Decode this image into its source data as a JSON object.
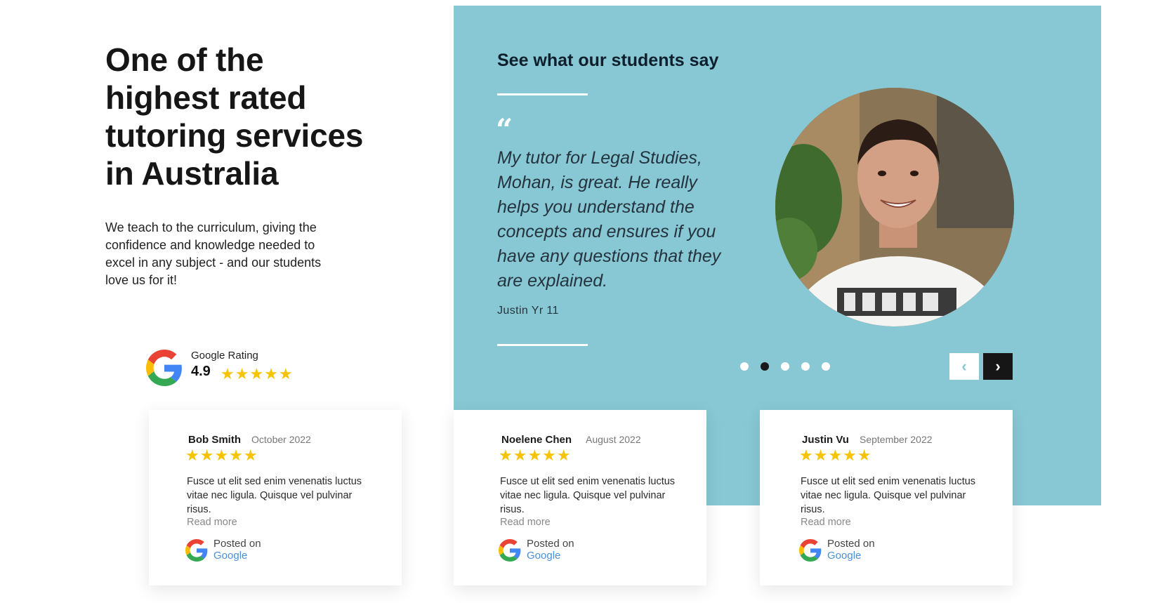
{
  "headline": "One of the highest rated tutoring services in Australia",
  "intro": "We teach to the curriculum, giving the confidence and knowledge needed to excel in any subject - and our students love us for it!",
  "google_rating": {
    "label": "Google Rating",
    "score": "4.9",
    "stars": "★★★★★"
  },
  "testimonial": {
    "section_title": "See what our students say",
    "quote_mark": "“",
    "quote": "My tutor for Legal Studies, Mohan, is great. He really helps you understand the concepts and ensures if you have any questions that they are explained.",
    "author": "Justin Yr 11",
    "slide_count": 5,
    "active_slide": 2,
    "prev_icon": "‹",
    "next_icon": "›"
  },
  "colors": {
    "panel": "#87c8d4",
    "star": "#f6c300",
    "google_link": "#4a90d9"
  },
  "reviews": [
    {
      "name": "Bob Smith",
      "date": "October 2022",
      "stars": "★★★★★",
      "text": "Fusce ut elit sed enim venenatis luctus vitae nec ligula. Quisque vel pulvinar risus.",
      "read_more": "Read more",
      "posted_on": "Posted on",
      "platform": "Google"
    },
    {
      "name": "Noelene Chen",
      "date": "August 2022",
      "stars": "★★★★★",
      "text": "Fusce ut elit sed enim venenatis luctus vitae nec ligula. Quisque vel pulvinar risus.",
      "read_more": "Read more",
      "posted_on": "Posted on",
      "platform": "Google"
    },
    {
      "name": "Justin Vu",
      "date": "September 2022",
      "stars": "★★★★★",
      "text": "Fusce ut elit sed enim venenatis luctus vitae nec ligula. Quisque vel pulvinar risus.",
      "read_more": "Read more",
      "posted_on": "Posted on",
      "platform": "Google"
    }
  ]
}
